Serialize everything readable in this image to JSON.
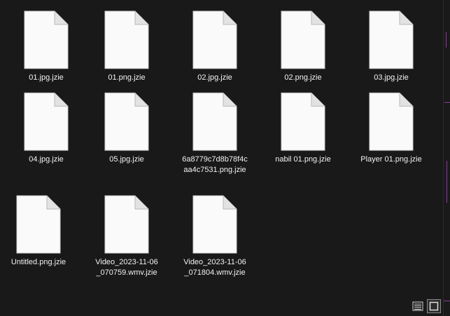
{
  "files": [
    {
      "name": "01.jpg.jzie"
    },
    {
      "name": "01.png.jzie"
    },
    {
      "name": "02.jpg.jzie"
    },
    {
      "name": "02.png.jzie"
    },
    {
      "name": "03.jpg.jzie"
    },
    {
      "name": "04.jpg.jzie"
    },
    {
      "name": "05.jpg.jzie"
    },
    {
      "name": "6a8779c7d8b78f4caa4c7531.png.jzie"
    },
    {
      "name": "nabil 01.png.jzie"
    },
    {
      "name": "Player 01.png.jzie"
    },
    {
      "name": "Untitled.png.jzie"
    },
    {
      "name": "Video_2023-11-06_070759.wmv.jzie"
    },
    {
      "name": "Video_2023-11-06_071804.wmv.jzie"
    }
  ],
  "statusbar": {
    "details_view_icon": "details-view-icon",
    "large_icons_view_icon": "large-icons-view-icon",
    "active_view": "large-icons"
  },
  "colors": {
    "background": "#191919",
    "text": "#f2f2f2",
    "file_icon": "#fafafa",
    "accent_desktop": "#8a3d9a"
  }
}
